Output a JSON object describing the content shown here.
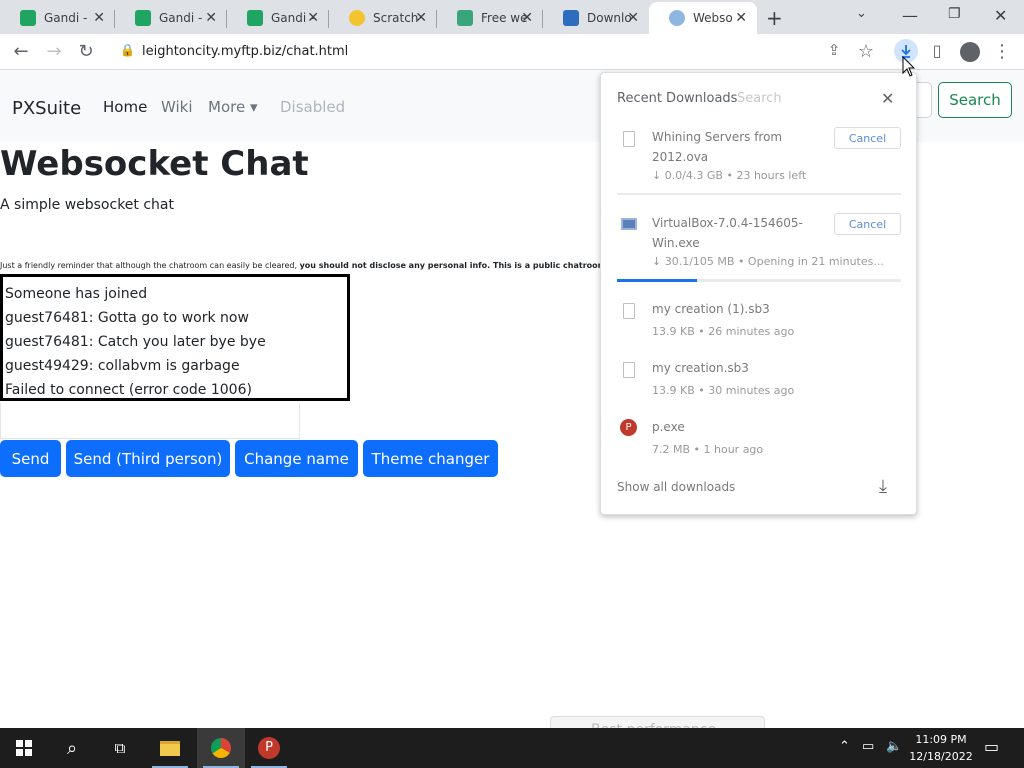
{
  "browser": {
    "tabs": [
      {
        "title": "Gandi -",
        "fav_color": "#1fa462",
        "active": false
      },
      {
        "title": "Gandi -",
        "fav_color": "#1fa462",
        "active": false
      },
      {
        "title": "Gandi -",
        "fav_color": "#1fa462",
        "active": false
      },
      {
        "title": "Scratch",
        "fav_color": "#f4c430",
        "active": false
      },
      {
        "title": "Free we",
        "fav_color": "#3aa57a",
        "active": false
      },
      {
        "title": "Downlo",
        "fav_color": "#2e6dbd",
        "active": false
      },
      {
        "title": "Webso",
        "fav_color": "#8fb6e0",
        "active": true
      }
    ],
    "url": "leightoncity.myftp.biz/chat.html"
  },
  "navbar": {
    "brand": "PXSuite",
    "links": [
      "Home",
      "Wiki",
      "More",
      "Disabled"
    ],
    "search_placeholder": "Search",
    "search_button": "Search"
  },
  "page": {
    "title": "Websocket Chat",
    "lead": "A simple websocket chat",
    "reminder_normal": "Just a friendly reminder that although the chatroom can easily be cleared, ",
    "reminder_bold": "you should not disclose any personal info. This is a public chatroom, anything you put here will be made public!",
    "messages": [
      "Someone has joined",
      "guest76481: Gotta go to work now",
      "guest76481: Catch you later bye bye",
      "guest49429: collabvm is garbage",
      "Failed to connect (error code 1006)"
    ],
    "buttons": [
      "Send",
      "Send (Third person)",
      "Change name",
      "Theme changer"
    ]
  },
  "downloads": {
    "header": "Recent Downloads",
    "header_ghost": "Search",
    "items": [
      {
        "name": "Whining Servers from 2012.ova",
        "status": "↓ 0.0/4.3 GB • 23 hours left",
        "cancel": "Cancel"
      },
      {
        "name": "VirtualBox-7.0.4-154605-Win.exe",
        "status": "↓ 30.1/105 MB • Opening in 21 minutes...",
        "cancel": "Cancel",
        "progress": 0.28
      },
      {
        "name": "my creation (1).sb3",
        "status": "13.9 KB • 26 minutes ago"
      },
      {
        "name": "my creation.sb3",
        "status": "13.9 KB • 30 minutes ago"
      },
      {
        "name": "p.exe",
        "status": "7.2 MB • 1 hour ago"
      }
    ],
    "show_all": "Show all downloads"
  },
  "taskbar": {
    "time": "11:09 PM",
    "date": "12/18/2022",
    "ghost_toast": "Best performance"
  },
  "colors": {
    "primary": "#0d6efd",
    "success": "#198754",
    "taskbar": "#1d1d1d"
  }
}
